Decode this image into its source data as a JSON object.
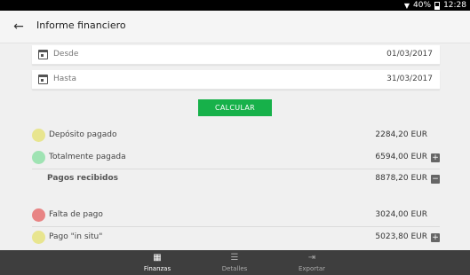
{
  "status_bar": {
    "battery": "40%",
    "time": "12:28"
  },
  "appbar": {
    "title": "Informe financiero"
  },
  "date_fields": {
    "from": {
      "label": "Desde",
      "value": "01/03/2017"
    },
    "to": {
      "label": "Hasta",
      "value": "31/03/2017"
    }
  },
  "calculate_button": "CALCULAR",
  "summary": {
    "deposit": {
      "label": "Depósito pagado",
      "amount": "2284,20 EUR",
      "color": "#e8e58f"
    },
    "fully_paid": {
      "label": "Totalmente pagada",
      "amount": "6594,00 EUR",
      "color": "#9fe3b3",
      "toggle": "+"
    },
    "received": {
      "label": "Pagos recibidos",
      "amount": "8878,20 EUR",
      "toggle": "−"
    },
    "no_payment": {
      "label": "Falta de pago",
      "amount": "3024,00 EUR",
      "color": "#e88484"
    },
    "on_site": {
      "label": "Pago \"in situ\"",
      "amount": "5023,80 EUR",
      "color": "#e8e58f",
      "toggle": "+"
    }
  },
  "bottom_nav": {
    "finances": {
      "label": "Finanzas",
      "icon": "calculator-icon"
    },
    "details": {
      "label": "Detalles",
      "icon": "list-icon"
    },
    "export": {
      "label": "Exportar",
      "icon": "export-icon"
    }
  }
}
